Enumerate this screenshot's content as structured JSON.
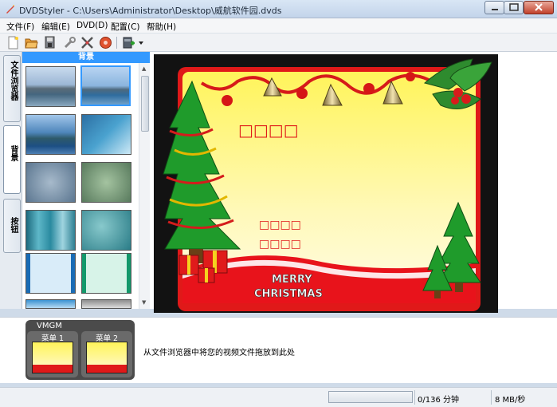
{
  "window": {
    "title": "DVDStyler - C:\\Users\\Administrator\\Desktop\\威航软件园.dvds"
  },
  "menu": [
    "文件(F)",
    "编辑(E)",
    "DVD(D)",
    "配置(C)",
    "帮助(H)"
  ],
  "toolbar": {
    "icons": [
      "new-icon",
      "open-icon",
      "save-icon",
      "tools-icon",
      "settings-icon",
      "burn-icon",
      "add-file-icon",
      "dropdown-icon"
    ]
  },
  "tabs": [
    "文件浏览器",
    "背景",
    "按钮"
  ],
  "background_panel": {
    "header": "背景",
    "selected_index": 1
  },
  "canvas": {
    "title_placeholder": "□□□□",
    "button_line_1": "□□□□",
    "button_line_2": "□□□□",
    "banner_line_1": "MERRY",
    "banner_line_2": "CHRISTMAS"
  },
  "bottom": {
    "vmgm_label": "VMGM",
    "menus": [
      "菜单 1",
      "菜单 2"
    ],
    "drop_hint": "从文件浏览器中将您的视频文件拖放到此处"
  },
  "status": {
    "duration": "0/136 分钟",
    "speed": "8 MB/秒"
  },
  "colors": {
    "accent": "#3399ff",
    "canvas_bg_top": "#fff76a",
    "canvas_bg_bottom": "#fff7c8",
    "red_wave": "#e8131b"
  }
}
